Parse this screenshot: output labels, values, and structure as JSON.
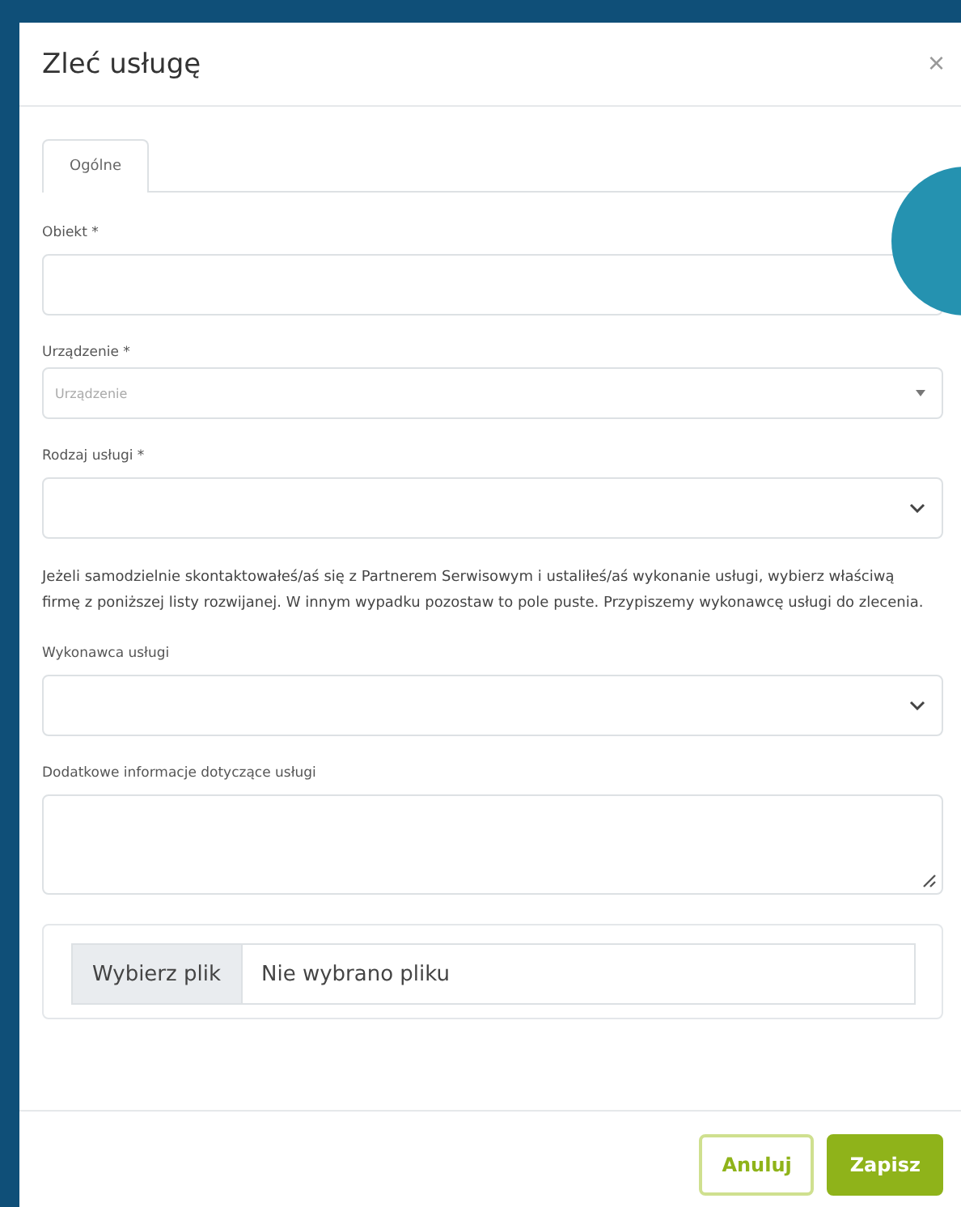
{
  "dialog": {
    "title": "Zleć usługę",
    "close": "×",
    "tabs": [
      {
        "label": "Ogólne",
        "selected": true
      }
    ],
    "fields": [
      {
        "kind": "input",
        "label": "Obiekt *"
      },
      {
        "kind": "dropdown",
        "label": "Urządzenie *",
        "placeholder": "Urządzenie"
      },
      {
        "kind": "select",
        "label": "Rodzaj usługi *"
      },
      {
        "kind": "note",
        "text": "Jeżeli samodzielnie skontaktowałeś/aś się z Partnerem Serwisowym i ustaliłeś/aś wykonanie usługi, wybierz właściwą firmę z poniższej listy rozwijanej. W innym wypadku pozostaw to pole puste. Przypiszemy wykonawcę usługi do zlecenia."
      },
      {
        "kind": "select",
        "label": "Wykonawca usługi"
      },
      {
        "kind": "textarea",
        "label": "Dodatkowe informacje dotyczące usługi"
      }
    ],
    "file": {
      "button": "Wybierz plik",
      "status": "Nie wybrano pliku"
    },
    "buttons": [
      {
        "label": "Anuluj",
        "kind": "secondary"
      },
      {
        "label": "Zapisz",
        "kind": "primary"
      }
    ]
  }
}
